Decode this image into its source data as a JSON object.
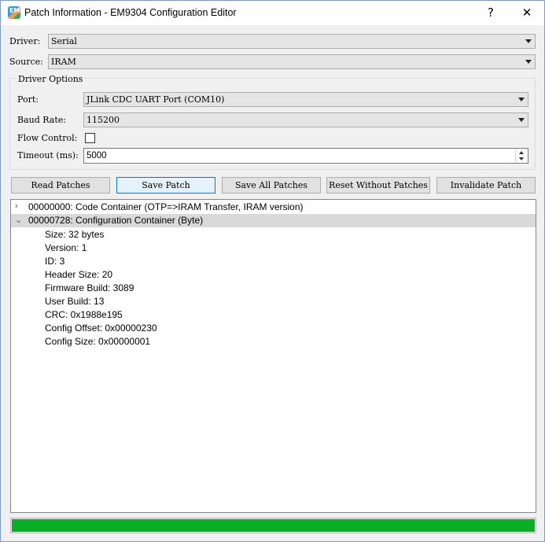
{
  "window": {
    "title": "Patch Information - EM9304 Configuration Editor",
    "help_glyph": "?",
    "close_glyph": "✕",
    "icon": "app-icon"
  },
  "driver": {
    "label": "Driver:",
    "value": "Serial"
  },
  "source": {
    "label": "Source:",
    "value": "IRAM"
  },
  "driver_options": {
    "title": "Driver Options",
    "port": {
      "label": "Port:",
      "value": "JLink CDC UART Port (COM10)"
    },
    "baud": {
      "label": "Baud Rate:",
      "value": "115200"
    },
    "flow_control": {
      "label": "Flow Control:",
      "checked": false
    },
    "timeout": {
      "label": "Timeout (ms):",
      "value": "5000"
    }
  },
  "buttons": {
    "read": "Read Patches",
    "save": "Save Patch",
    "save_all": "Save All Patches",
    "reset": "Reset Without Patches",
    "invalidate": "Invalidate Patch"
  },
  "tree": {
    "nodes": [
      {
        "caret": ">",
        "text": "00000000: Code Container (OTP=>IRAM Transfer, IRAM version)",
        "expanded": false
      },
      {
        "caret": "v",
        "text": "00000728: Configuration Container (Byte)",
        "expanded": true,
        "children": [
          "Size: 32 bytes",
          "Version: 1",
          "ID: 3",
          "Header Size: 20",
          "Firmware Build: 3089",
          "User Build: 13",
          "CRC: 0x1988e195",
          "Config Offset: 0x00000230",
          "Config Size: 0x00000001"
        ]
      }
    ]
  },
  "progress": {
    "percent": 100,
    "color": "#06b025"
  }
}
